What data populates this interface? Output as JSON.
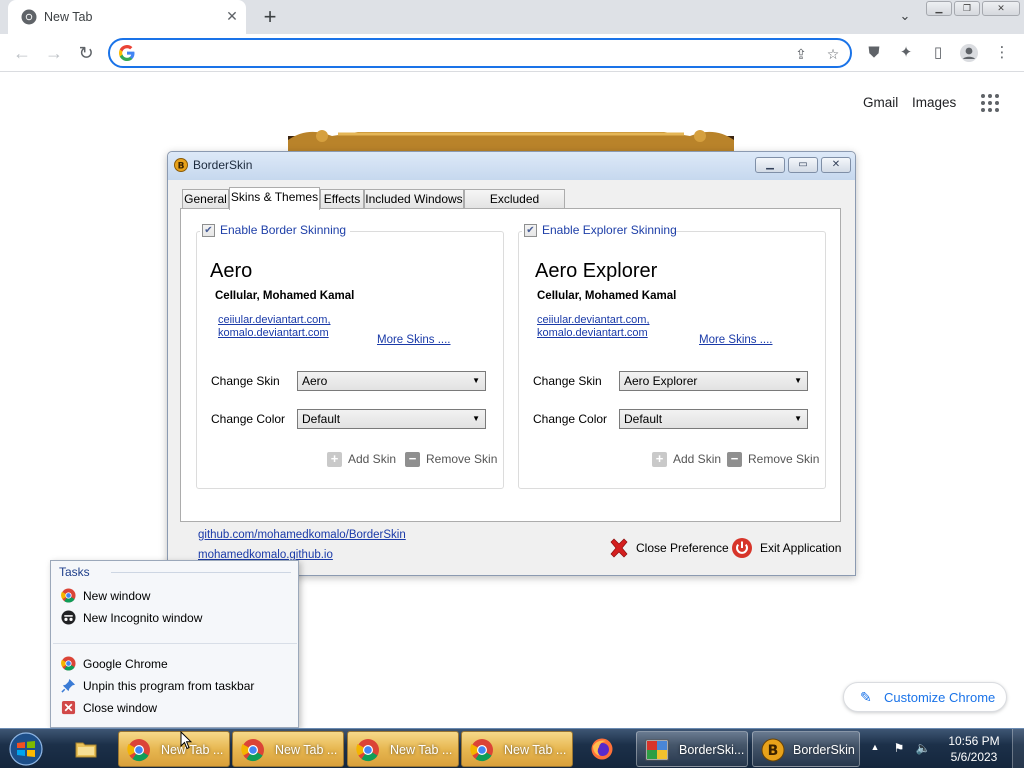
{
  "browser": {
    "tab": {
      "title": "New Tab"
    },
    "omnibox": {
      "value": "",
      "placeholder": ""
    },
    "ntp": {
      "gmail": "Gmail",
      "images": "Images",
      "customize": "Customize Chrome"
    }
  },
  "borderskin": {
    "title": "BorderSkin",
    "tabs": [
      "General",
      "Skins & Themes",
      "Effects",
      "Included Windows",
      "Excluded Windows"
    ],
    "active_tab": "Skins & Themes",
    "left": {
      "enable_label": "Enable Border Skinning",
      "checked": true,
      "skin_name": "Aero",
      "author": "CeIIular, Mohamed Kamal",
      "link1": "ceiiular.deviantart.com,",
      "link2": "komalo.deviantart.com",
      "more": "More Skins ....",
      "change_skin_label": "Change Skin",
      "change_skin_value": "Aero",
      "change_color_label": "Change Color",
      "change_color_value": "Default",
      "add": "Add Skin",
      "remove": "Remove Skin"
    },
    "right": {
      "enable_label": "Enable Explorer Skinning",
      "checked": true,
      "skin_name": "Aero Explorer",
      "author": "CeIIular, Mohamed Kamal",
      "link1": "ceiiular.deviantart.com,",
      "link2": "komalo.deviantart.com",
      "more": "More Skins ....",
      "change_skin_label": "Change Skin",
      "change_skin_value": "Aero Explorer",
      "change_color_label": "Change Color",
      "change_color_value": "Default",
      "add": "Add Skin",
      "remove": "Remove Skin"
    },
    "footer": {
      "github_link": "github.com/mohamedkomalo/BorderSkin",
      "site_link": "mohamedkomalo.github.io",
      "close_pref": "Close Preference",
      "exit_app": "Exit Application"
    }
  },
  "jumplist": {
    "header": "Tasks",
    "tasks": [
      "New window",
      "New Incognito window"
    ],
    "app": [
      "Google Chrome",
      "Unpin this program from taskbar",
      "Close window"
    ]
  },
  "taskbar": {
    "items": [
      "New Tab ...",
      "New Tab ...",
      "New Tab ...",
      "New Tab ...",
      "BorderSki...",
      "BorderSkin"
    ],
    "clock_time": "10:56 PM",
    "clock_date": "5/6/2023"
  },
  "colors": {
    "accent": "#1a73e8",
    "link": "#1a3aa8",
    "taskbar": "#1c3049",
    "chrome_taskbar_highlight": "#e7b751"
  }
}
